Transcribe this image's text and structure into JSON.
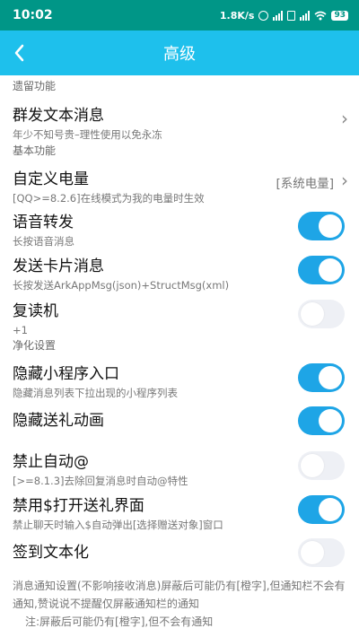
{
  "status": {
    "time": "10:02",
    "network_speed": "1.8K/s",
    "battery": "93"
  },
  "header": {
    "title": "高级"
  },
  "sections": {
    "legacy": "遗留功能",
    "basic": "基本功能",
    "clean": "净化设置"
  },
  "items": {
    "group_send": {
      "label": "群发文本消息",
      "desc": "年少不知号贵–理性使用以免永冻"
    },
    "custom_battery": {
      "label": "自定义电量",
      "desc": "[QQ>=8.2.6]在线模式为我的电量时生效",
      "value": "[系统电量]"
    },
    "voice_forward": {
      "label": "语音转发",
      "desc": "长按语音消息",
      "enabled": true
    },
    "send_card": {
      "label": "发送卡片消息",
      "desc": "长按发送ArkAppMsg(json)+StructMsg(xml)",
      "enabled": true
    },
    "repeater": {
      "label": "复读机",
      "desc": "+1",
      "enabled": false
    },
    "hide_miniprogram": {
      "label": "隐藏小程序入口",
      "desc": "隐藏消息列表下拉出现的小程序列表",
      "enabled": true
    },
    "hide_gift_anim": {
      "label": "隐藏送礼动画",
      "enabled": true
    },
    "disable_auto_at": {
      "label": "禁止自动@",
      "desc": "[>=8.1.3]去除回复消息时自动@特性",
      "enabled": false
    },
    "disable_gift_ui": {
      "label": "禁用$打开送礼界面",
      "desc": "禁止聊天时输入$自动弹出[选择赠送对象]窗口",
      "enabled": true
    },
    "checkin_text": {
      "label": "签到文本化",
      "enabled": false
    }
  },
  "notes": {
    "main": "消息通知设置(不影响接收消息)屏蔽后可能仍有[橙字],但通知栏不会有通知,赞说说不提醒仅屏蔽通知栏的通知",
    "sub": "注:屏蔽后可能仍有[橙字],但不会有通知"
  },
  "colors": {
    "status_bar": "#009687",
    "header": "#1ec0ec",
    "toggle_on": "#1ea5e6",
    "toggle_off": "#eef0f5"
  }
}
